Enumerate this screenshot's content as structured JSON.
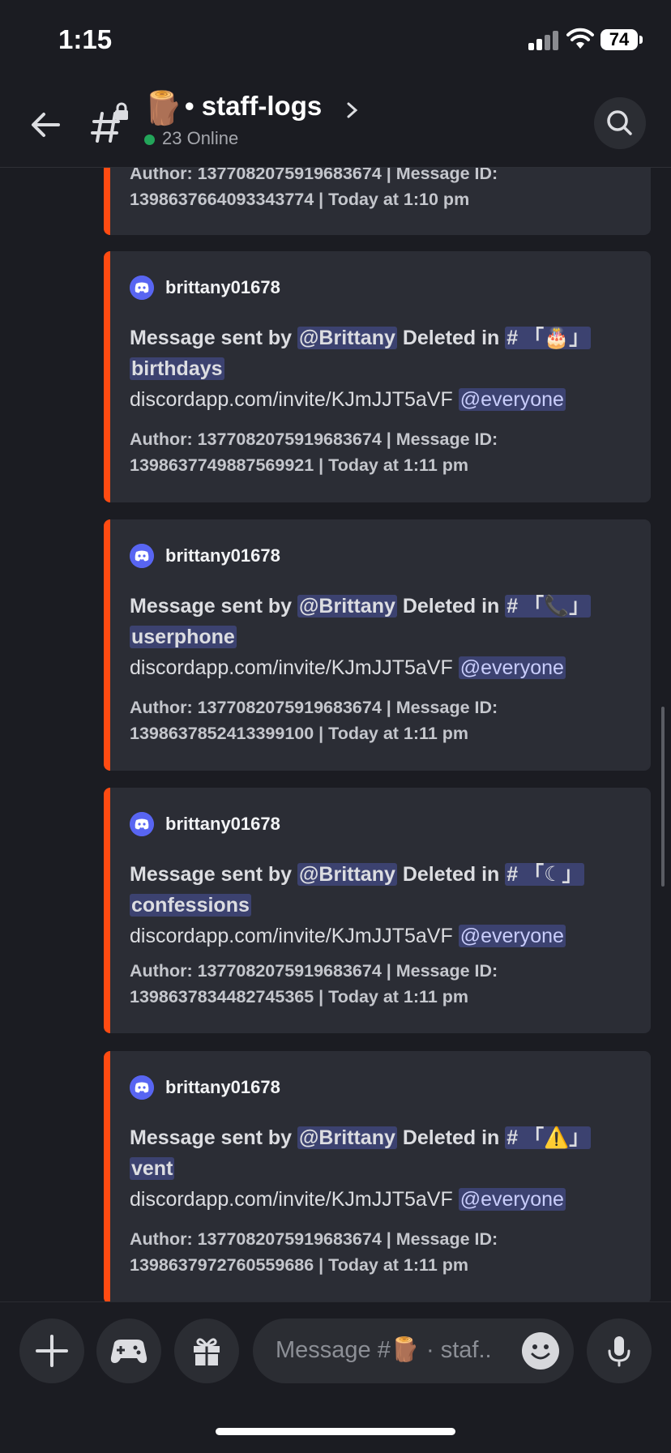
{
  "status": {
    "time": "1:15",
    "battery": "74"
  },
  "header": {
    "channel_emoji": "🪵",
    "channel_name": "• staff-logs",
    "online": "23 Online"
  },
  "top_embed": {
    "footer_line1": "Author: 1377082075919683674 | Message ID:",
    "footer_line2": "1398637664093343774 | Today at 1:10 pm"
  },
  "embeds": [
    {
      "author": "brittany01678",
      "prefix": "Message sent by ",
      "user_mention": "@Brittany",
      "deleted_in": " Deleted in ",
      "channel_mention": "# 「🎂」",
      "channel_name": "birthdays",
      "link": "discordapp.com/invite/KJmJJT5aVF",
      "everyone": "@everyone",
      "footer_line1": "Author: 1377082075919683674 | Message ID:",
      "footer_line2": "1398637749887569921 | Today at 1:11 pm"
    },
    {
      "author": "brittany01678",
      "prefix": "Message sent by ",
      "user_mention": "@Brittany",
      "deleted_in": " Deleted in ",
      "channel_mention": "# 「📞」",
      "channel_name": "userphone",
      "link": "discordapp.com/invite/KJmJJT5aVF",
      "everyone": "@everyone",
      "footer_line1": "Author: 1377082075919683674 | Message ID:",
      "footer_line2": "1398637852413399100 | Today at 1:11 pm"
    },
    {
      "author": "brittany01678",
      "prefix": "Message sent by ",
      "user_mention": "@Brittany",
      "deleted_in": " Deleted in ",
      "channel_mention": "# 「☾」",
      "channel_name": "confessions",
      "link": "discordapp.com/invite/KJmJJT5aVF",
      "everyone": "@everyone",
      "footer_line1": "Author: 1377082075919683674 | Message ID:",
      "footer_line2": "1398637834482745365 | Today at 1:11 pm"
    },
    {
      "author": "brittany01678",
      "prefix": "Message sent by ",
      "user_mention": "@Brittany",
      "deleted_in": " Deleted in ",
      "channel_mention": "# 「⚠️」",
      "channel_name": "vent",
      "link": "discordapp.com/invite/KJmJJT5aVF",
      "everyone": "@everyone",
      "footer_line1": "Author: 1377082075919683674 | Message ID:",
      "footer_line2": "1398637972760559686 | Today at 1:11 pm"
    }
  ],
  "composer": {
    "placeholder": "Message #🪵 · staf.."
  },
  "colors": {
    "embed_bar": "#ff4b12",
    "mention_bg": "#3c4270",
    "online": "#23a55a",
    "blurple": "#5865f2"
  }
}
